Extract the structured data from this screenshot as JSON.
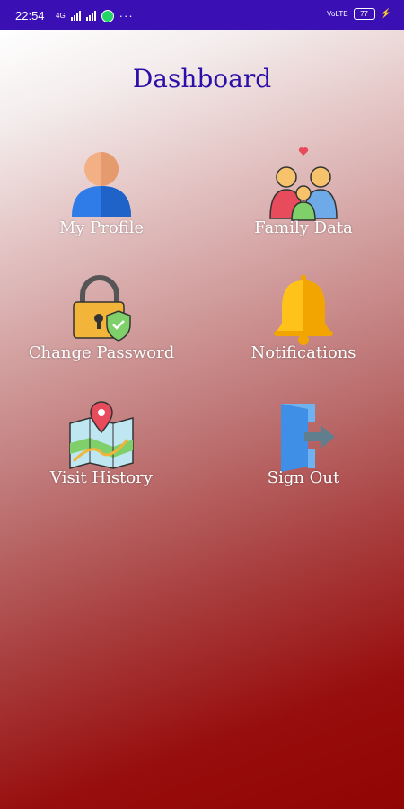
{
  "status_bar": {
    "time": "22:54",
    "net_small_left": "4G",
    "net_small_right": "VoLTE",
    "battery": "77"
  },
  "dashboard": {
    "title": "Dashboard",
    "tiles": [
      {
        "label": "My Profile",
        "icon": "profile-icon"
      },
      {
        "label": "Family Data",
        "icon": "family-icon"
      },
      {
        "label": "Change Password",
        "icon": "padlock-shield-icon"
      },
      {
        "label": "Notifications",
        "icon": "bell-icon"
      },
      {
        "label": "Visit History",
        "icon": "map-pin-icon"
      },
      {
        "label": "Sign Out",
        "icon": "sign-out-icon"
      }
    ]
  },
  "colors": {
    "status_bar": "#3a10b4",
    "title": "#2a10a8",
    "gradient_bottom": "#920505"
  }
}
